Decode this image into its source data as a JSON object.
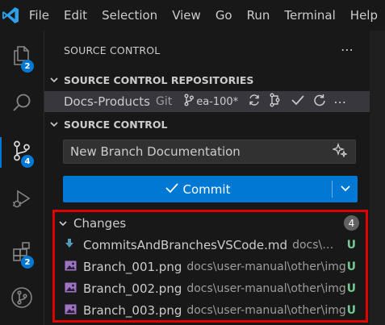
{
  "menu": [
    "File",
    "Edit",
    "Selection",
    "View",
    "Go",
    "Run",
    "Terminal",
    "Help"
  ],
  "activity": {
    "explorer_badge": "2",
    "scm_badge": "4",
    "extensions_badge": "2"
  },
  "panel": {
    "title": "SOURCE CONTROL",
    "repositories_header": "SOURCE CONTROL REPOSITORIES",
    "repo": {
      "name": "Docs-Products",
      "type": "Git",
      "branch": "ea-100*"
    },
    "scm_header": "SOURCE CONTROL",
    "commit_message": "New Branch Documentation",
    "commit_label": "Commit",
    "changes": {
      "label": "Changes",
      "count": "4",
      "files": [
        {
          "name": "CommitsAndBranchesVSCode.md",
          "path": "docs\\user...",
          "status": "U",
          "icon": "markdown-download-icon"
        },
        {
          "name": "Branch_001.png",
          "path": "docs\\user-manual\\other\\img",
          "status": "U",
          "icon": "image-icon"
        },
        {
          "name": "Branch_002.png",
          "path": "docs\\user-manual\\other\\img",
          "status": "U",
          "icon": "image-icon"
        },
        {
          "name": "Branch_003.png",
          "path": "docs\\user-manual\\other\\img",
          "status": "U",
          "icon": "image-icon"
        }
      ]
    }
  },
  "colors": {
    "accent": "#0078d4",
    "highlight_border": "#e00000",
    "untracked": "#73c991"
  }
}
